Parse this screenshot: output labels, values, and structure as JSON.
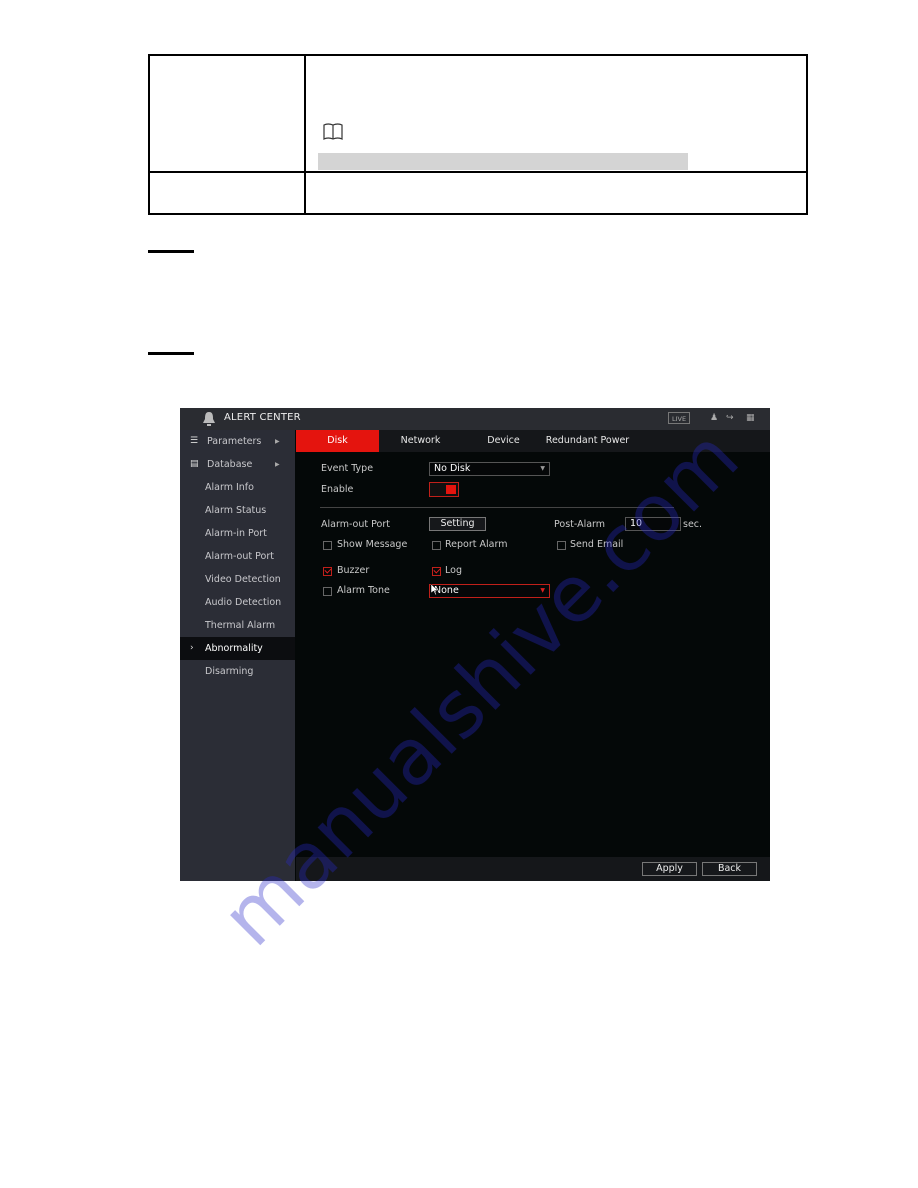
{
  "document": {
    "table": {
      "rows": 2,
      "note_icon": "book-note-icon"
    },
    "steps": 2
  },
  "app": {
    "title": "ALERT CENTER",
    "header": {
      "live_label": "LIVE",
      "icons": [
        "bell-icon",
        "user-icon",
        "logout-icon",
        "grid-icon"
      ]
    },
    "sidebar": {
      "items": [
        {
          "label": "Parameters",
          "icon": "list-icon",
          "expandable": true
        },
        {
          "label": "Database",
          "icon": "database-icon",
          "expandable": true
        },
        {
          "label": "Alarm Info"
        },
        {
          "label": "Alarm Status"
        },
        {
          "label": "Alarm-in Port"
        },
        {
          "label": "Alarm-out Port"
        },
        {
          "label": "Video Detection"
        },
        {
          "label": "Audio Detection"
        },
        {
          "label": "Thermal Alarm"
        },
        {
          "label": "Abnormality",
          "active": true
        },
        {
          "label": "Disarming"
        }
      ]
    },
    "tabs": [
      {
        "label": "Disk",
        "active": true
      },
      {
        "label": "Network"
      },
      {
        "label": "Device"
      },
      {
        "label": "Redundant Power"
      }
    ],
    "form": {
      "event_type_label": "Event Type",
      "event_type_value": "No Disk",
      "enable_label": "Enable",
      "enable_on": true,
      "alarm_out_label": "Alarm-out Port",
      "setting_button": "Setting",
      "post_alarm_label": "Post-Alarm",
      "post_alarm_value": "10",
      "post_alarm_unit": "sec.",
      "checkboxes": [
        {
          "label": "Show Message",
          "checked": false
        },
        {
          "label": "Report Alarm",
          "checked": false
        },
        {
          "label": "Send Email",
          "checked": false
        },
        {
          "label": "Buzzer",
          "checked": true
        },
        {
          "label": "Log",
          "checked": true
        },
        {
          "label": "Alarm Tone",
          "checked": false
        }
      ],
      "alarm_tone_value": "None"
    },
    "footer": {
      "apply": "Apply",
      "back": "Back"
    },
    "accent_color": "#e4140e"
  },
  "watermark": "manualshive.com"
}
